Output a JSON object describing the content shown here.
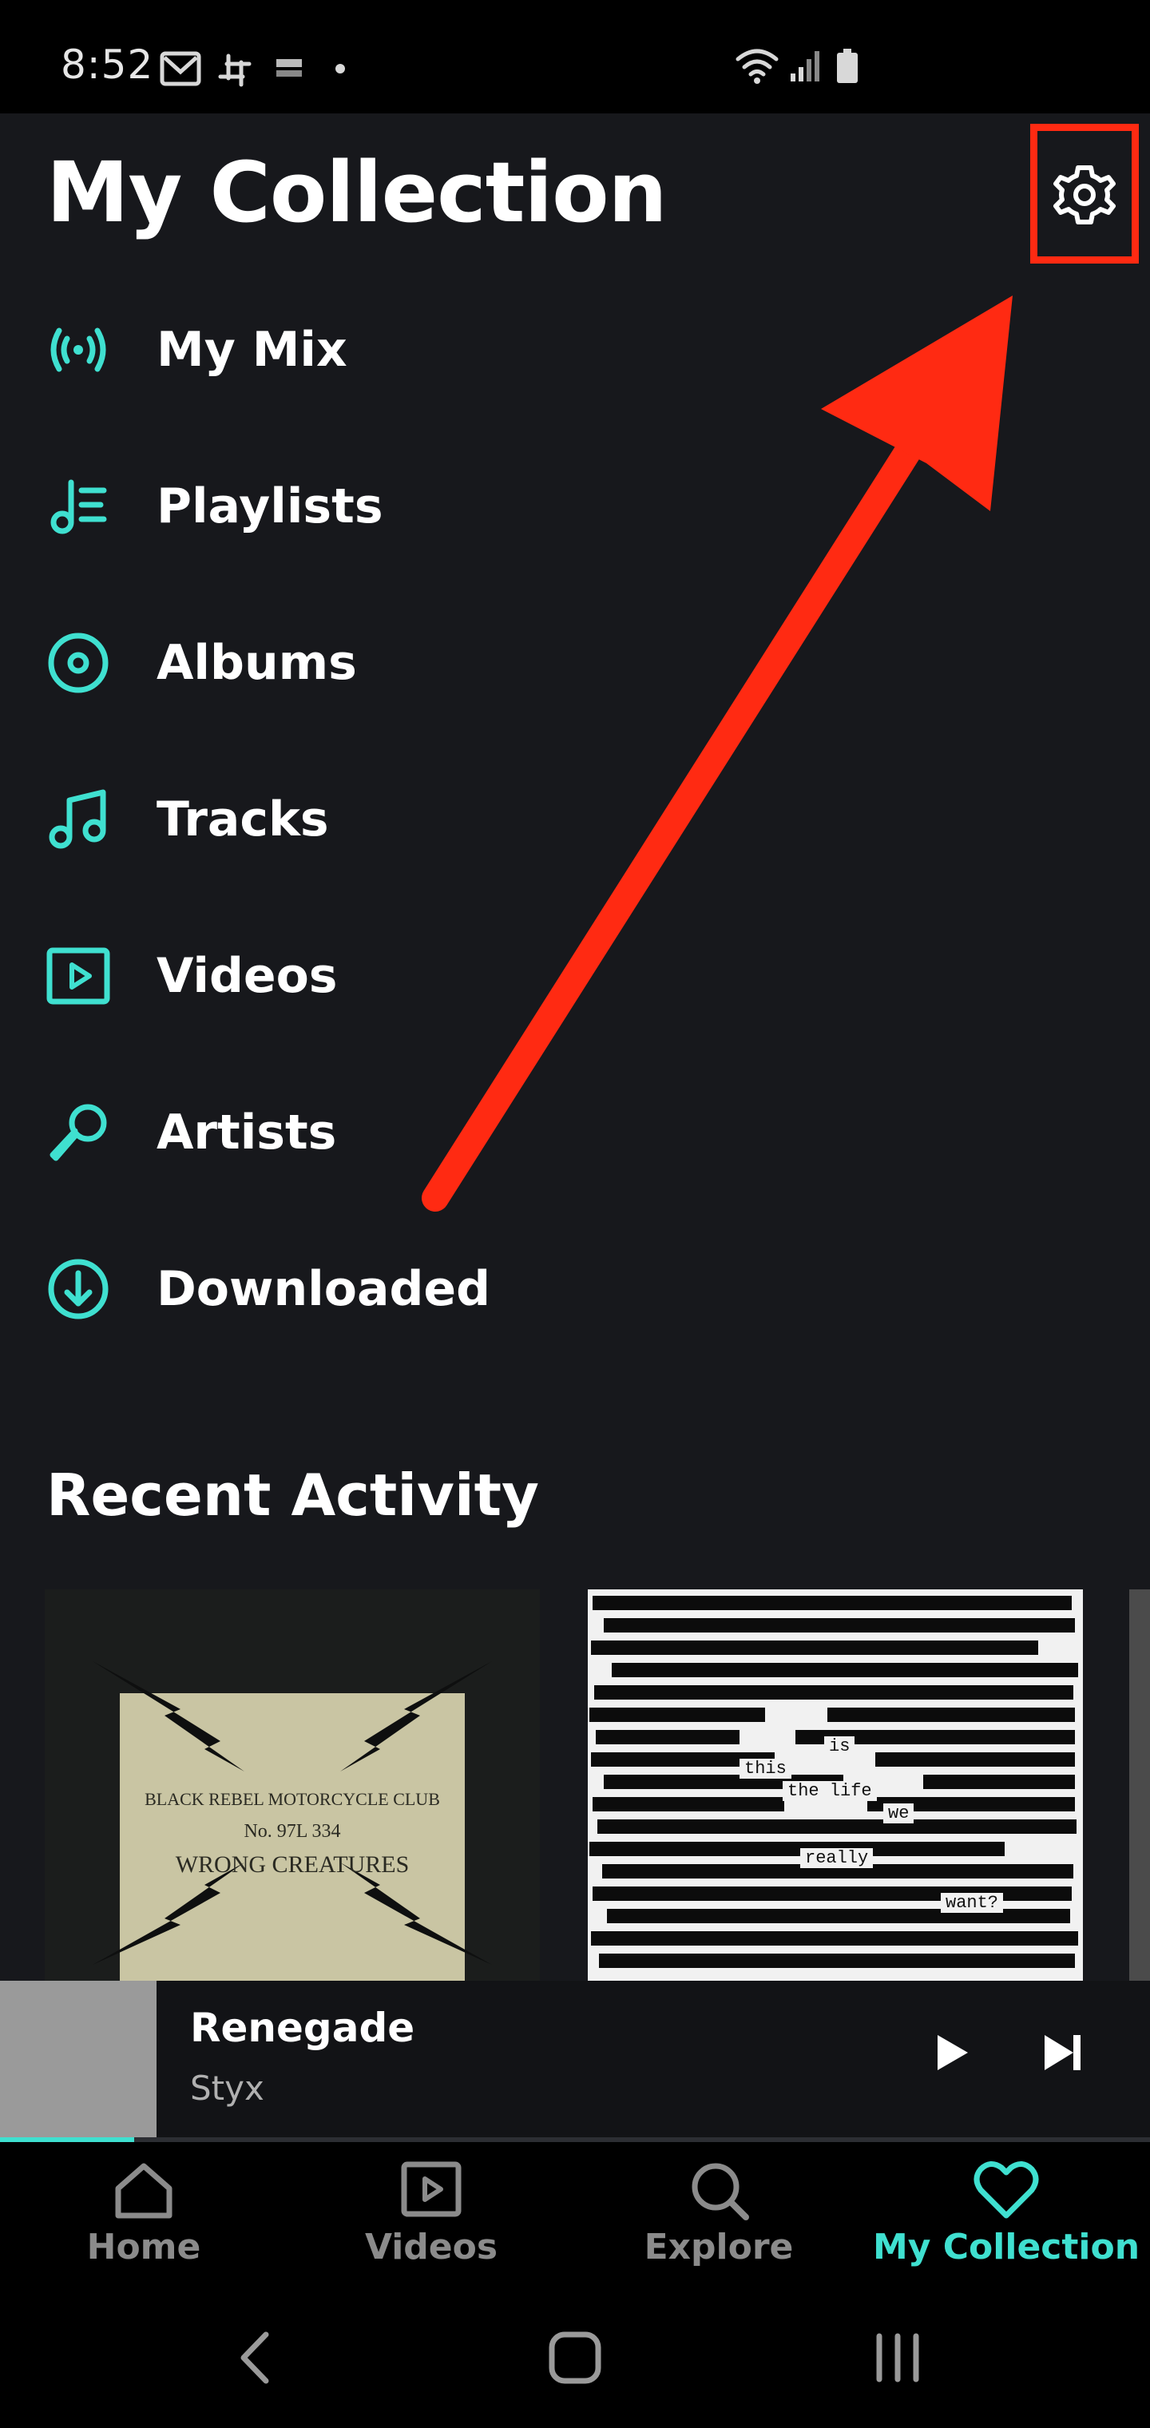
{
  "status_bar": {
    "time": "8:52"
  },
  "header": {
    "title": "My Collection"
  },
  "menu": {
    "items": [
      {
        "label": "My Mix",
        "icon": "radio-broadcast-icon"
      },
      {
        "label": "Playlists",
        "icon": "playlist-icon"
      },
      {
        "label": "Albums",
        "icon": "album-disc-icon"
      },
      {
        "label": "Tracks",
        "icon": "music-note-icon"
      },
      {
        "label": "Videos",
        "icon": "video-play-icon"
      },
      {
        "label": "Artists",
        "icon": "microphone-icon"
      },
      {
        "label": "Downloaded",
        "icon": "download-circle-icon"
      }
    ]
  },
  "recent": {
    "title": "Recent Activity",
    "cards": [
      {
        "lines": [
          "BLACK REBEL MOTORCYCLE CLUB",
          "No. 97L 334",
          "WRONG CREATURES"
        ]
      },
      {
        "lines": [
          "is",
          "this",
          "the life",
          "we",
          "really",
          "want?"
        ]
      }
    ]
  },
  "player": {
    "title": "Renegade",
    "artist": "Styx",
    "progress": 0.117
  },
  "nav": {
    "items": [
      {
        "label": "Home",
        "icon": "home-icon",
        "active": false
      },
      {
        "label": "Videos",
        "icon": "video-icon",
        "active": false
      },
      {
        "label": "Explore",
        "icon": "search-icon",
        "active": false
      },
      {
        "label": "My Collection",
        "icon": "heart-icon",
        "active": true
      }
    ]
  },
  "colors": {
    "accent": "#3fe0d0",
    "background": "#17181c",
    "annotation": "#ff2a12"
  }
}
